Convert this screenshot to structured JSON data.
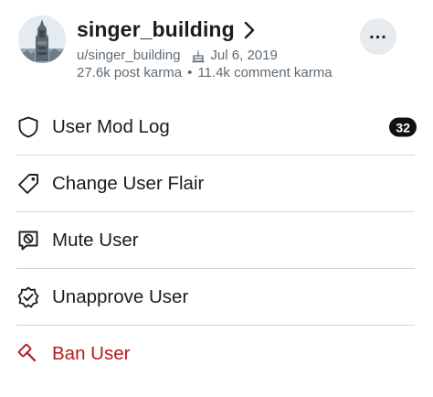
{
  "profile": {
    "display_name": "singer_building",
    "handle": "u/singer_building",
    "cake_day": "Jul 6, 2019",
    "post_karma": "27.6k post karma",
    "separator": "•",
    "comment_karma": "11.4k comment karma",
    "avatar_icon": "avatar-tower-image",
    "more_label": "..."
  },
  "menu": {
    "items": [
      {
        "label": "User Mod Log",
        "icon": "shield-icon",
        "badge": "32"
      },
      {
        "label": "Change User Flair",
        "icon": "tag-icon"
      },
      {
        "label": "Mute User",
        "icon": "mute-chat-icon"
      },
      {
        "label": "Unapprove User",
        "icon": "badge-check-icon"
      },
      {
        "label": "Ban User",
        "icon": "gavel-icon"
      }
    ]
  },
  "colors": {
    "danger": "#b81a1e",
    "badge_bg": "#111111",
    "meta_text": "#5f6b74",
    "more_button_bg": "#e7ebee"
  }
}
